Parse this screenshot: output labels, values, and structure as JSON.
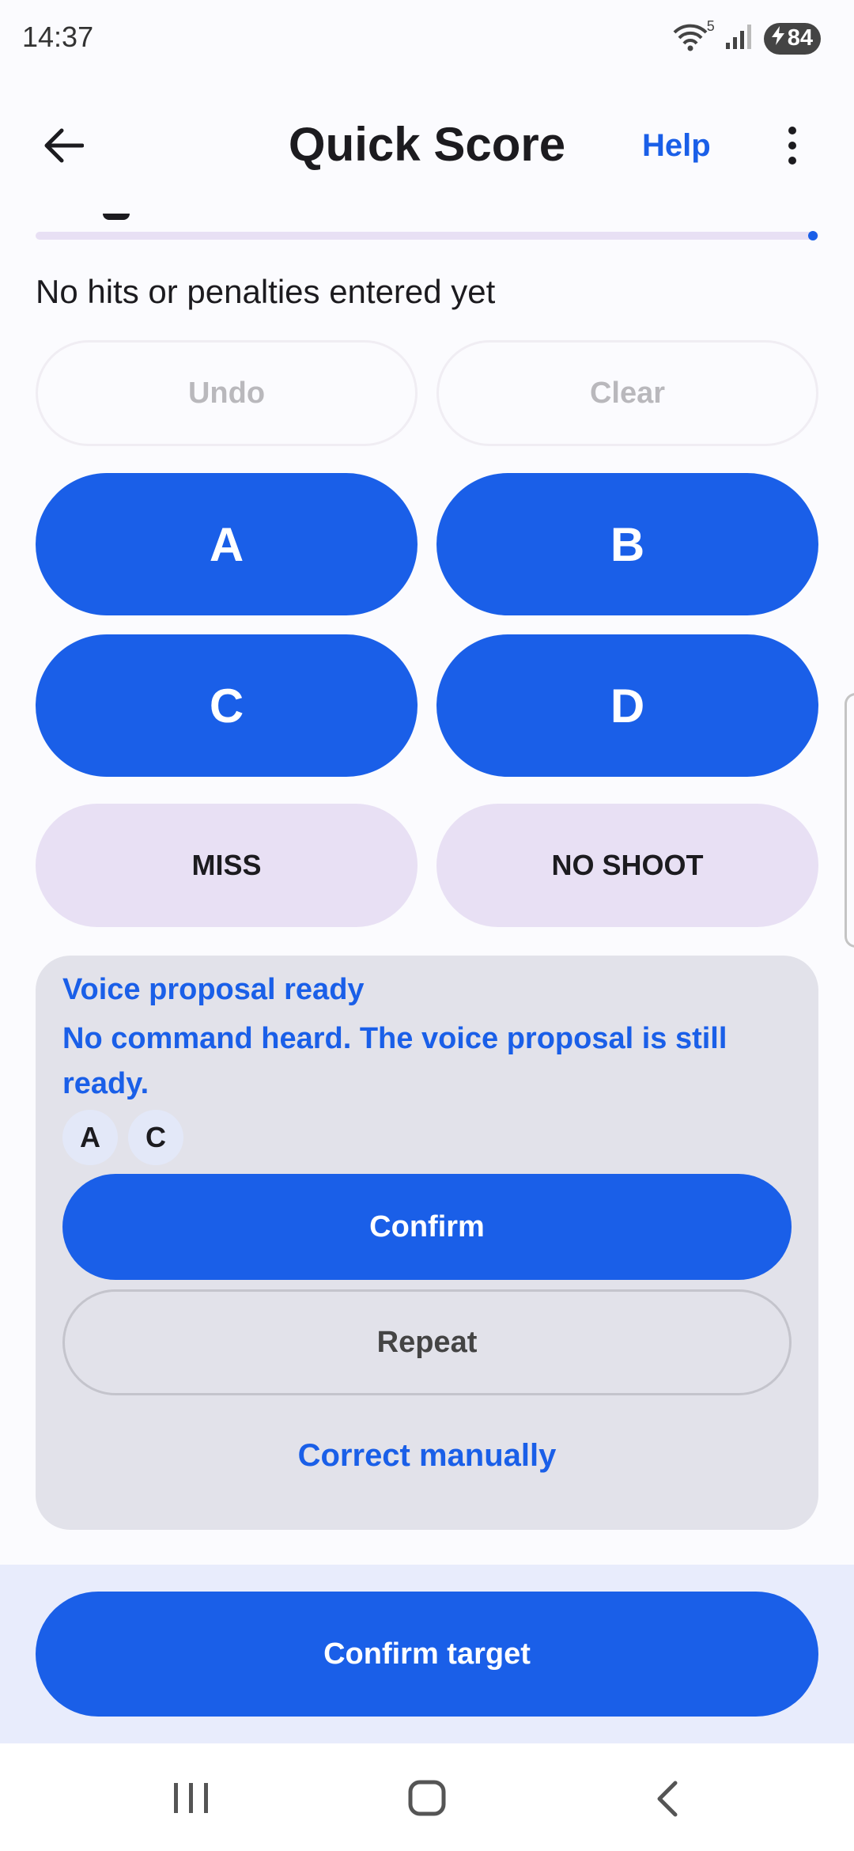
{
  "status_bar": {
    "time": "14:37",
    "wifi_badge": "5",
    "battery": "84"
  },
  "app_bar": {
    "title": "Quick Score",
    "help_label": "Help",
    "icons": [
      "back-arrow-icon",
      "more-vert-icon"
    ]
  },
  "entry": {
    "progress": 1.0,
    "summary": "No hits or penalties entered yet",
    "undo_label": "Undo",
    "clear_label": "Clear"
  },
  "scoring_buttons": {
    "a": "A",
    "b": "B",
    "c": "C",
    "d": "D",
    "miss": "MISS",
    "no_shoot": "NO SHOOT"
  },
  "voice": {
    "title": "Voice proposal ready",
    "message": "No command heard. The voice proposal is still ready.",
    "chips": [
      "A",
      "C"
    ],
    "confirm_label": "Confirm",
    "repeat_label": "Repeat",
    "correct_label": "Correct manually"
  },
  "footer": {
    "confirm_target_label": "Confirm target"
  },
  "colors": {
    "primary": "#1a5fe8",
    "tonal": "#e8e0f4",
    "card": "#e2e2ea",
    "background": "#fbfbfe"
  }
}
